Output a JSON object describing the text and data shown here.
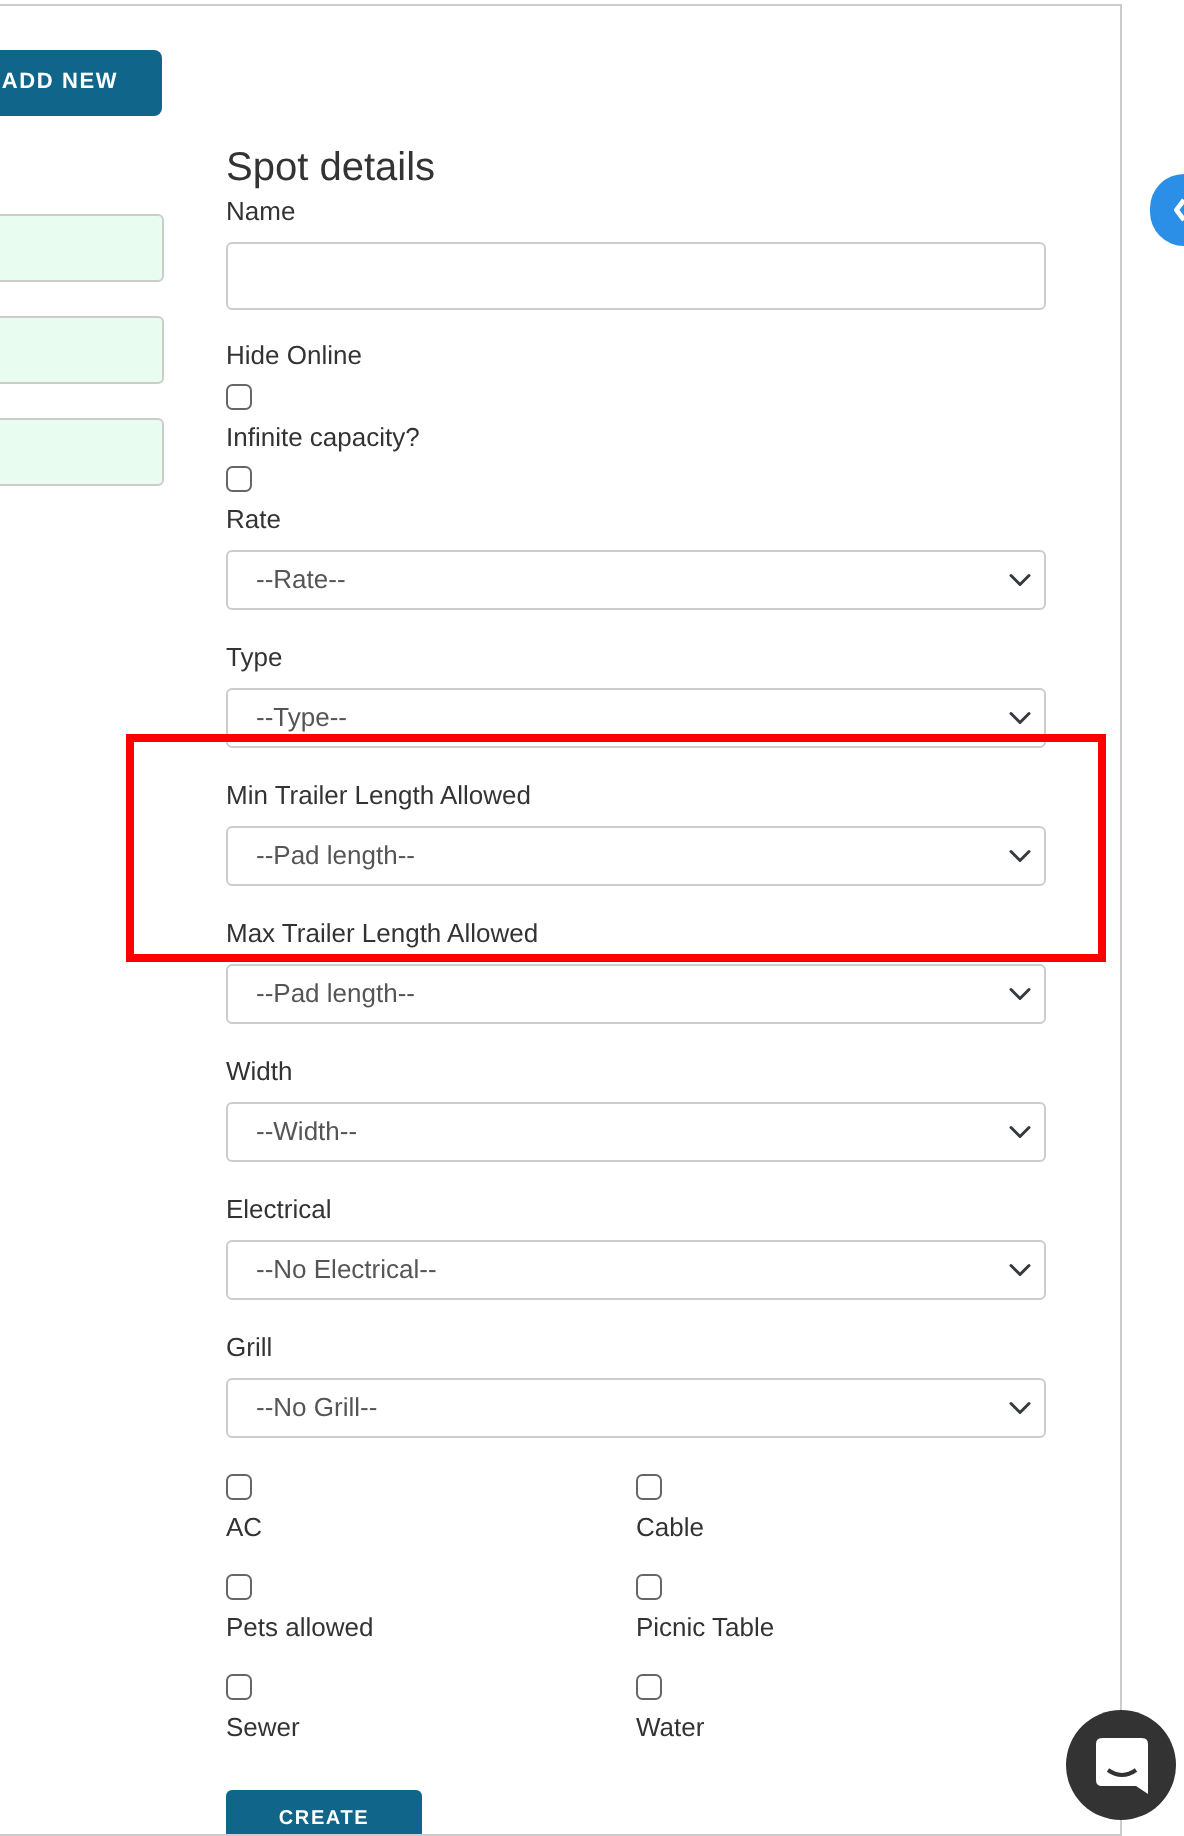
{
  "add_button": {
    "label": "ADD NEW"
  },
  "left_fields": [
    {
      "kind": "input"
    },
    {
      "kind": "input"
    },
    {
      "kind": "input"
    }
  ],
  "form": {
    "title": "Spot details",
    "fields": [
      {
        "kind": "text",
        "label": "Name"
      },
      {
        "kind": "checkbox",
        "label": "Hide Online",
        "checked": false
      },
      {
        "kind": "checkbox",
        "label": "Infinite capacity?",
        "checked": false
      },
      {
        "kind": "select",
        "label": "Rate",
        "value": "--Rate--"
      },
      {
        "kind": "select",
        "label": "Type",
        "value": "--Type--"
      },
      {
        "kind": "select",
        "label": "Min Trailer Length Allowed",
        "value": "--Pad length--"
      },
      {
        "kind": "select",
        "label": "Max Trailer Length Allowed",
        "value": "--Pad length--"
      },
      {
        "kind": "select",
        "label": "Width",
        "value": "--Width--"
      },
      {
        "kind": "select",
        "label": "Electrical",
        "value": "--No Electrical--"
      },
      {
        "kind": "select",
        "label": "Grill",
        "value": "--No Grill--"
      }
    ],
    "amenities": [
      {
        "label": "AC",
        "checked": false
      },
      {
        "label": "Cable",
        "checked": false
      },
      {
        "label": "Pets allowed",
        "checked": false
      },
      {
        "label": "Picnic Table",
        "checked": false
      },
      {
        "label": "Sewer",
        "checked": false
      },
      {
        "label": "Water",
        "checked": false
      }
    ],
    "submit": "CREATE"
  },
  "highlight_frame": true
}
